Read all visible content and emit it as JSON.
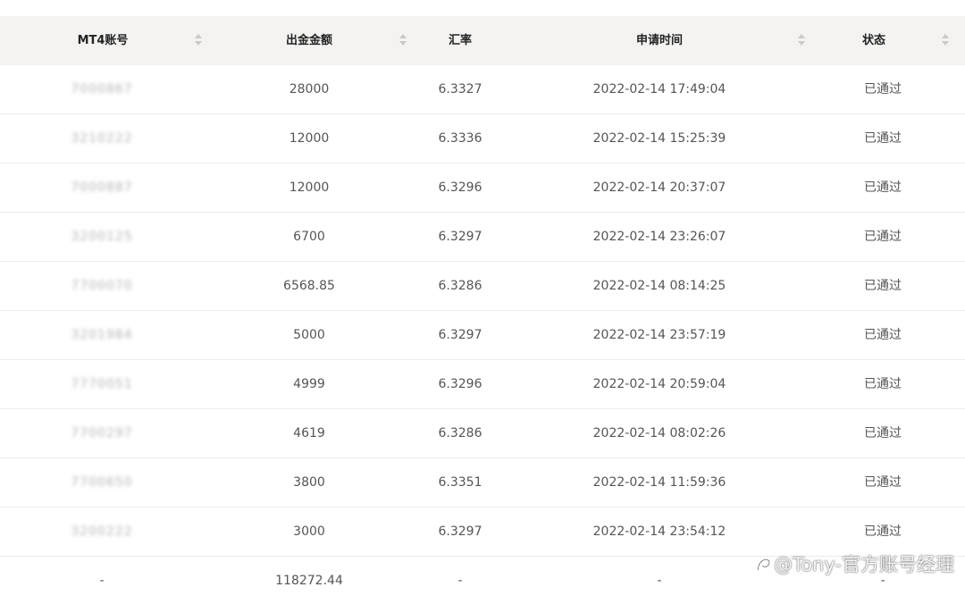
{
  "table": {
    "headers": {
      "account": "MT4账号",
      "amount": "出金金额",
      "rate": "汇率",
      "time": "申请时间",
      "status": "状态"
    },
    "rows": [
      {
        "account": "7000867",
        "amount": "28000",
        "rate": "6.3327",
        "time": "2022-02-14 17:49:04",
        "status": "已通过"
      },
      {
        "account": "3210222",
        "amount": "12000",
        "rate": "6.3336",
        "time": "2022-02-14 15:25:39",
        "status": "已通过"
      },
      {
        "account": "7000887",
        "amount": "12000",
        "rate": "6.3296",
        "time": "2022-02-14 20:37:07",
        "status": "已通过"
      },
      {
        "account": "3200125",
        "amount": "6700",
        "rate": "6.3297",
        "time": "2022-02-14 23:26:07",
        "status": "已通过"
      },
      {
        "account": "7700070",
        "amount": "6568.85",
        "rate": "6.3286",
        "time": "2022-02-14 08:14:25",
        "status": "已通过"
      },
      {
        "account": "3201984",
        "amount": "5000",
        "rate": "6.3297",
        "time": "2022-02-14 23:57:19",
        "status": "已通过"
      },
      {
        "account": "7770051",
        "amount": "4999",
        "rate": "6.3296",
        "time": "2022-02-14 20:59:04",
        "status": "已通过"
      },
      {
        "account": "7700297",
        "amount": "4619",
        "rate": "6.3286",
        "time": "2022-02-14 08:02:26",
        "status": "已通过"
      },
      {
        "account": "7700650",
        "amount": "3800",
        "rate": "6.3351",
        "time": "2022-02-14 11:59:36",
        "status": "已通过"
      },
      {
        "account": "3200222",
        "amount": "3000",
        "rate": "6.3297",
        "time": "2022-02-14 23:54:12",
        "status": "已通过"
      }
    ],
    "total": {
      "account": "-",
      "amount": "118272.44",
      "rate": "-",
      "time": "-",
      "status": "-"
    }
  },
  "watermark": {
    "text": "@Tony-官方账号经理",
    "icon": "zhihu-logo-icon"
  }
}
